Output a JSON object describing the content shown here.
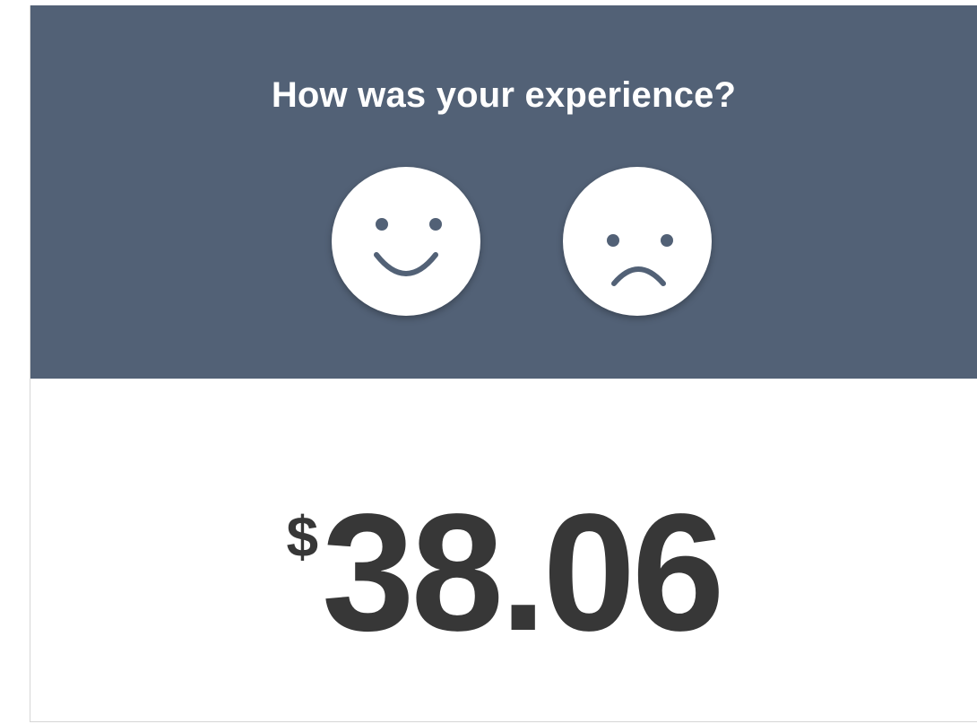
{
  "feedback": {
    "prompt": "How was your experience?",
    "icons": [
      "smile-face-icon",
      "frown-face-icon"
    ],
    "colors": {
      "panel_background": "#526176",
      "face_fill": "#ffffff",
      "face_features": "#526176"
    }
  },
  "total": {
    "currency_symbol": "$",
    "amount": "38.06",
    "color": "#373737"
  }
}
